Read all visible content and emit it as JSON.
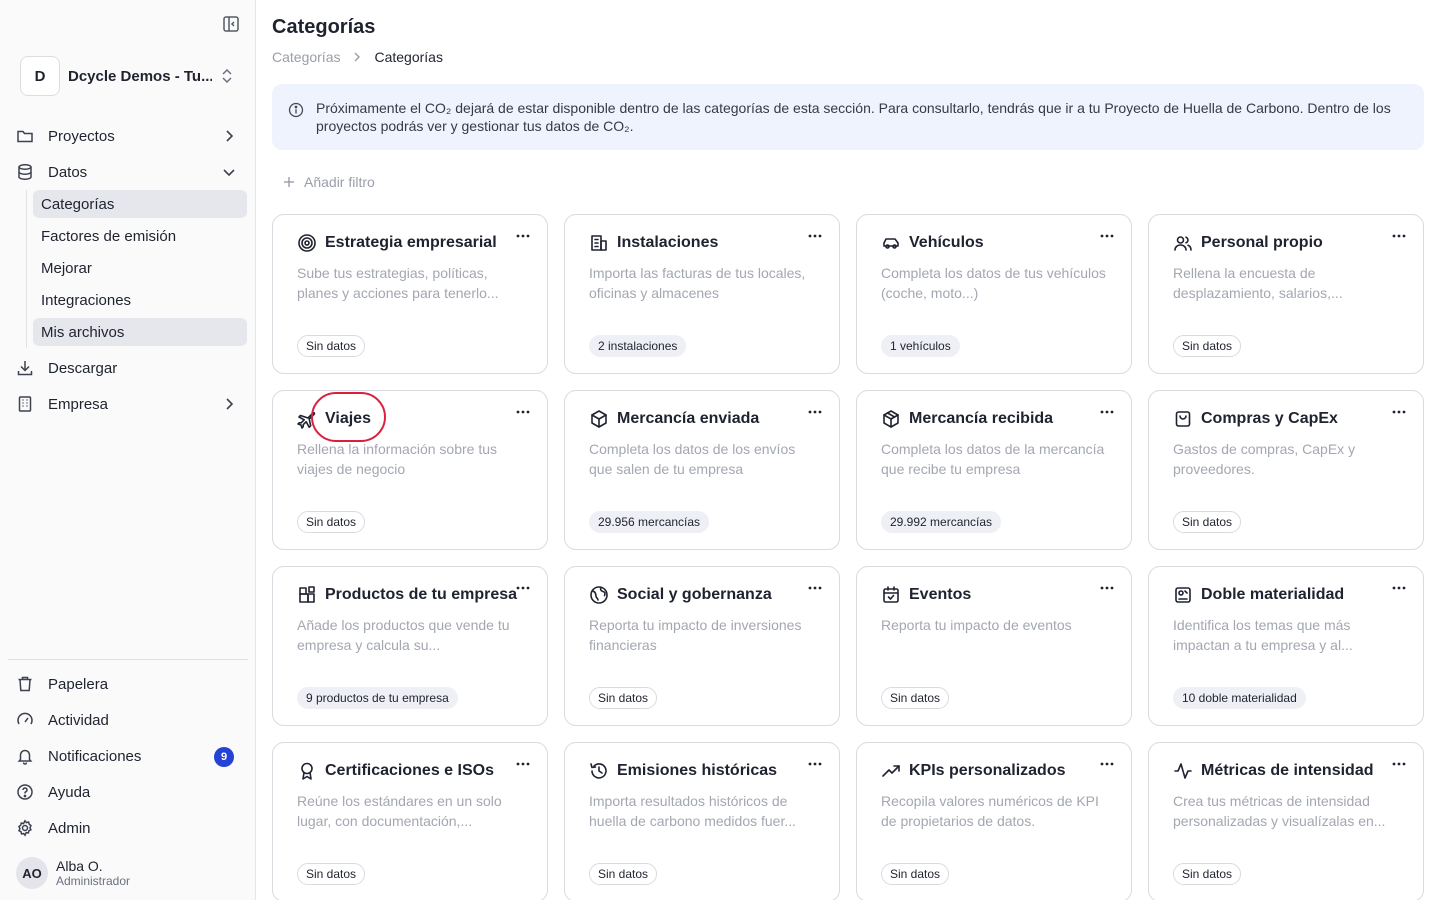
{
  "sidebar": {
    "org": {
      "initial": "D",
      "name": "Dcycle Demos - Tu..."
    },
    "nav": {
      "proyectos": "Proyectos",
      "datos": "Datos",
      "descargar": "Descargar",
      "empresa": "Empresa"
    },
    "datos_items": [
      {
        "label": "Categorías",
        "active": true
      },
      {
        "label": "Factores de emisión"
      },
      {
        "label": "Mejorar"
      },
      {
        "label": "Integraciones"
      },
      {
        "label": "Mis archivos",
        "active": true
      }
    ],
    "bottom": {
      "papelera": "Papelera",
      "actividad": "Actividad",
      "notificaciones": "Notificaciones",
      "notificaciones_count": "9",
      "ayuda": "Ayuda",
      "admin": "Admin"
    },
    "user": {
      "initials": "AO",
      "name": "Alba O.",
      "role": "Administrador"
    }
  },
  "main": {
    "title": "Categorías",
    "breadcrumb": [
      "Categorías",
      "Categorías"
    ],
    "banner": "Próximamente el CO₂ dejará de estar disponible dentro de las categorías de esta sección. Para consultarlo, tendrás que ir a tu Proyecto de Huella de Carbono. Dentro de los proyectos podrás ver y gestionar tus datos de CO₂.",
    "add_filter": "Añadir filtro",
    "cards": [
      {
        "icon": "target-icon",
        "title": "Estrategia empresarial",
        "desc": "Sube tus estrategias, políticas, planes y acciones para tenerlo...",
        "badge": "Sin datos",
        "filled": false
      },
      {
        "icon": "building-icon",
        "title": "Instalaciones",
        "desc": "Importa las facturas de tus locales, oficinas y almacenes",
        "badge": "2 instalaciones",
        "filled": true
      },
      {
        "icon": "car-icon",
        "title": "Vehículos",
        "desc": "Completa los datos de tus vehículos (coche, moto...)",
        "badge": "1 vehículos",
        "filled": true
      },
      {
        "icon": "users-icon",
        "title": "Personal propio",
        "desc": "Rellena la encuesta de desplazamiento, salarios,...",
        "badge": "Sin datos",
        "filled": false
      },
      {
        "icon": "plane-icon",
        "title": "Viajes",
        "desc": "Rellena la información sobre tus viajes de negocio",
        "badge": "Sin datos",
        "filled": false
      },
      {
        "icon": "box-icon",
        "title": "Mercancía enviada",
        "desc": "Completa los datos de los envíos que salen de tu empresa",
        "badge": "29.956 mercancías",
        "filled": true
      },
      {
        "icon": "boxes-icon",
        "title": "Mercancía recibida",
        "desc": "Completa los datos de la mercancía que recibe tu empresa",
        "badge": "29.992 mercancías",
        "filled": true
      },
      {
        "icon": "shopping-bag-icon",
        "title": "Compras y CapEx",
        "desc": "Gastos de compras, CapEx y proveedores.",
        "badge": "Sin datos",
        "filled": false
      },
      {
        "icon": "products-icon",
        "title": "Productos de tu empresa",
        "desc": "Añade los productos que vende tu empresa y calcula su...",
        "badge": "9 productos de tu empresa",
        "filled": true
      },
      {
        "icon": "globe-icon",
        "title": "Social y gobernanza",
        "desc": "Reporta tu impacto de inversiones financieras",
        "badge": "Sin datos",
        "filled": false
      },
      {
        "icon": "calendar-icon",
        "title": "Eventos",
        "desc": "Reporta tu impacto de eventos",
        "badge": "Sin datos",
        "filled": false
      },
      {
        "icon": "materiality-icon",
        "title": "Doble materialidad",
        "desc": "Identifica los temas que más impactan a tu empresa y al...",
        "badge": "10 doble materialidad",
        "filled": true
      },
      {
        "icon": "award-icon",
        "title": "Certificaciones e ISOs",
        "desc": "Reúne los estándares en un solo lugar, con documentación,...",
        "badge": "Sin datos",
        "filled": false
      },
      {
        "icon": "history-icon",
        "title": "Emisiones históricas",
        "desc": "Importa resultados históricos de huella de carbono medidos fuer...",
        "badge": "Sin datos",
        "filled": false
      },
      {
        "icon": "trending-up-icon",
        "title": "KPIs personalizados",
        "desc": "Recopila valores numéricos de KPI de propietarios de datos.",
        "badge": "Sin datos",
        "filled": false
      },
      {
        "icon": "activity-icon",
        "title": "Métricas de intensidad",
        "desc": "Crea tus métricas de intensidad personalizadas y visualízalas en...",
        "badge": "Sin datos",
        "filled": false
      }
    ]
  }
}
